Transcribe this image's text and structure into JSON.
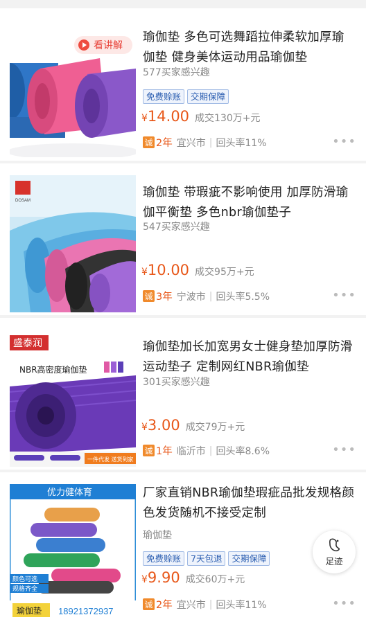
{
  "products": [
    {
      "title": "瑜伽垫 多色可选舞蹈拉伸柔软加厚瑜伽垫 健身美体运动用品瑜伽垫",
      "interest": "577买家感兴趣",
      "tags": [
        "免费赊账",
        "交期保障"
      ],
      "explain_label": "看讲解",
      "price": "14.00",
      "deal": "成交130万+元",
      "cheng": "诚",
      "years": "2年",
      "city": "宜兴市",
      "repurchase": "回头率11%"
    },
    {
      "title": "瑜伽垫 带瑕疵不影响使用 加厚防滑瑜伽平衡垫 多色nbr瑜伽垫子",
      "interest": "547买家感兴趣",
      "logo_text": "DOSAM",
      "price": "10.00",
      "deal": "成交95万+元",
      "cheng": "诚",
      "years": "3年",
      "city": "宁波市",
      "repurchase": "回头率5.5%"
    },
    {
      "title": "瑜伽垫加长加宽男女士健身垫加厚防滑运动垫子 定制网红NBR瑜伽垫",
      "interest": "301买家感兴趣",
      "img_brand": "盛泰润",
      "img_caption": "NBR高密度瑜伽垫",
      "img_footer": "一件代发 送货到家",
      "price": "3.00",
      "deal": "成交79万+元",
      "cheng": "诚",
      "years": "1年",
      "city": "临沂市",
      "repurchase": "回头率8.6%"
    },
    {
      "title": "厂家直销NBR瑜伽垫瑕疵品批发规格颜色发货随机不接受定制",
      "subline": "瑜伽垫",
      "tags": [
        "免费赊账",
        "7天包退",
        "交期保障"
      ],
      "img_banner": "优力健体育",
      "img_feature_1": "颜色可选",
      "img_feature_2": "规格齐全",
      "img_label": "瑜伽垫",
      "img_phone": "18921372937",
      "price": "9.90",
      "deal": "成交60万+元",
      "cheng": "诚",
      "years": "2年",
      "city": "宜兴市",
      "repurchase": "回头率11%"
    }
  ],
  "currency": "¥",
  "more_dots": "•••",
  "separator": "|",
  "footprint": {
    "label": "足迹",
    "icon": "footprint-icon"
  },
  "colors": {
    "price": "#e8581a",
    "tag_text": "#2a5db0",
    "cheng_badge": "#f08a2c"
  }
}
